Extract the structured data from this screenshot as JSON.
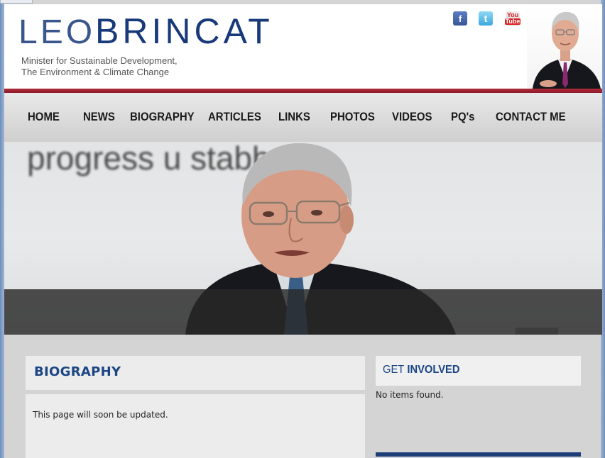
{
  "header": {
    "logo_first": "LEO",
    "logo_last": "BRINCAT",
    "tagline_line1": "Minister for Sustainable Development,",
    "tagline_line2": "The Environment & Climate Change",
    "social": [
      {
        "name": "facebook-icon",
        "glyph": "f"
      },
      {
        "name": "twitter-icon",
        "glyph": "t"
      },
      {
        "name": "youtube-icon",
        "glyph_top": "You",
        "glyph_bottom": "Tube"
      }
    ]
  },
  "nav": {
    "items": [
      "HOME",
      "NEWS",
      "BIOGRAPHY",
      "ARTICLES",
      "LINKS",
      "PHOTOS",
      "VIDEOS",
      "PQ's",
      "CONTACT ME"
    ]
  },
  "hero": {
    "banner_text": "progress u stabb"
  },
  "main": {
    "title": "BIOGRAPHY",
    "body": "This page will soon be updated."
  },
  "sidebar": {
    "title_light": "GET",
    "title_bold": "INVOLVED",
    "empty_text": "No items found."
  },
  "colors": {
    "brand_blue": "#183a7a",
    "accent_red": "#9c2232",
    "heading_blue": "#1b4585"
  }
}
